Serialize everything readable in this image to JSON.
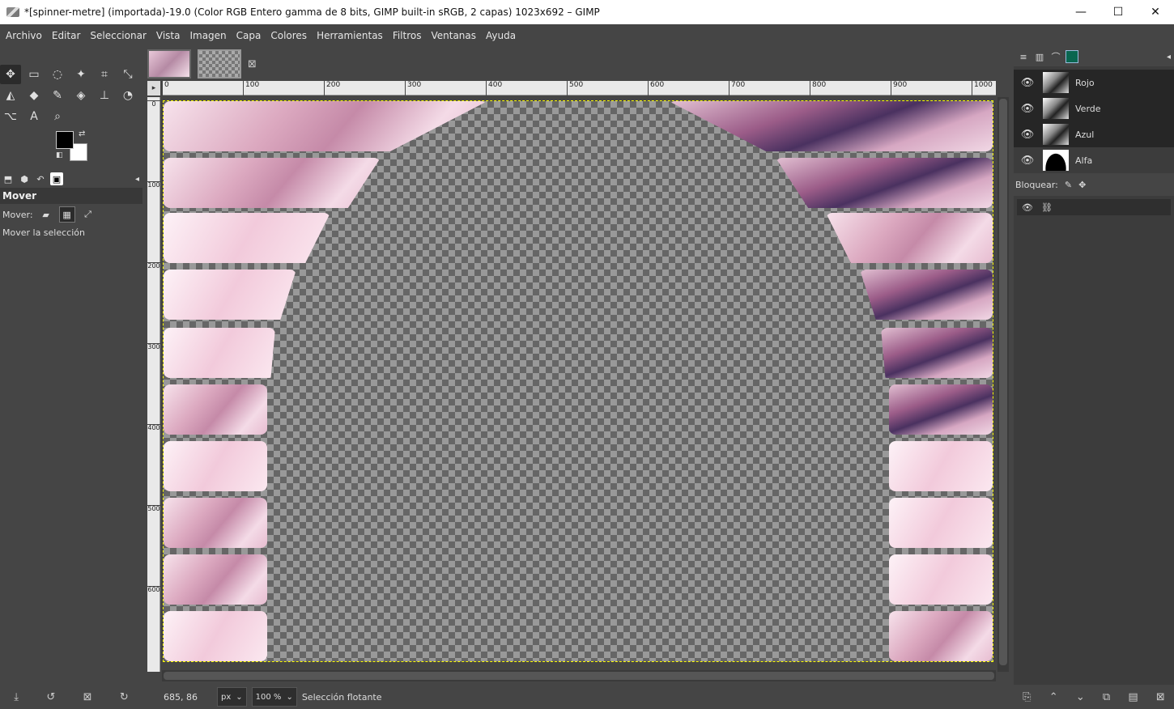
{
  "window": {
    "title": "*[spinner-metre] (importada)-19.0 (Color RGB Entero gamma de 8 bits, GIMP built-in sRGB, 2 capas) 1023x692 – GIMP",
    "minimize": "—",
    "maximize": "☐",
    "close": "✕"
  },
  "menu": [
    "Archivo",
    "Editar",
    "Seleccionar",
    "Vista",
    "Imagen",
    "Capa",
    "Colores",
    "Herramientas",
    "Filtros",
    "Ventanas",
    "Ayuda"
  ],
  "toolbox": {
    "tools": [
      {
        "name": "move-tool-icon",
        "glyph": "✥"
      },
      {
        "name": "rect-select-tool-icon",
        "glyph": "▭"
      },
      {
        "name": "free-select-tool-icon",
        "glyph": "◌"
      },
      {
        "name": "fuzzy-select-tool-icon",
        "glyph": "✦"
      },
      {
        "name": "crop-tool-icon",
        "glyph": "⌗"
      },
      {
        "name": "unified-transform-tool-icon",
        "glyph": "⤡"
      },
      {
        "name": "warp-transform-tool-icon",
        "glyph": "◭"
      },
      {
        "name": "bucket-fill-tool-icon",
        "glyph": "◆"
      },
      {
        "name": "paintbrush-tool-icon",
        "glyph": "✎"
      },
      {
        "name": "eraser-tool-icon",
        "glyph": "◈"
      },
      {
        "name": "clone-tool-icon",
        "glyph": "⊥"
      },
      {
        "name": "smudge-tool-icon",
        "glyph": "◔"
      },
      {
        "name": "paths-tool-icon",
        "glyph": "⌥"
      },
      {
        "name": "text-tool-icon",
        "glyph": "A"
      },
      {
        "name": "zoom-tool-icon",
        "glyph": "⌕"
      }
    ],
    "dock_tabs": [
      "⬒",
      "⬢",
      "↶",
      "▣"
    ],
    "tool_options_title": "Mover",
    "move_label": "Mover:",
    "move_status": "Mover la selección",
    "bottom_icons": [
      "⤓",
      "↺",
      "⊠",
      "↻"
    ]
  },
  "image_tabs": {
    "close": "⊠"
  },
  "ruler": {
    "top": [
      "0",
      "100",
      "200",
      "300",
      "400",
      "500",
      "600",
      "700",
      "800",
      "900",
      "1000"
    ],
    "left": [
      "0",
      "100",
      "200",
      "300",
      "400",
      "500",
      "600"
    ]
  },
  "status": {
    "coords": "685, 86",
    "unit": "px",
    "zoom": "100 %",
    "message": "Selección flotante"
  },
  "layers_panel": {
    "tabs": [
      "≡",
      "▥",
      "⌒"
    ],
    "layers": [
      {
        "name": "Rojo",
        "eye": "👁"
      },
      {
        "name": "Verde",
        "eye": "👁"
      },
      {
        "name": "Azul",
        "eye": "👁"
      },
      {
        "name": "Alfa",
        "eye": "👁"
      }
    ],
    "lock_label": "Bloquear:",
    "bottom_icons": [
      "⎘",
      "⌃",
      "⌄",
      "⧉",
      "▤",
      "⊠"
    ]
  },
  "colors": {
    "accent": "#0a6650",
    "selection": "#ffff00",
    "panel": "#454545",
    "titlebar": "#ffffff"
  }
}
